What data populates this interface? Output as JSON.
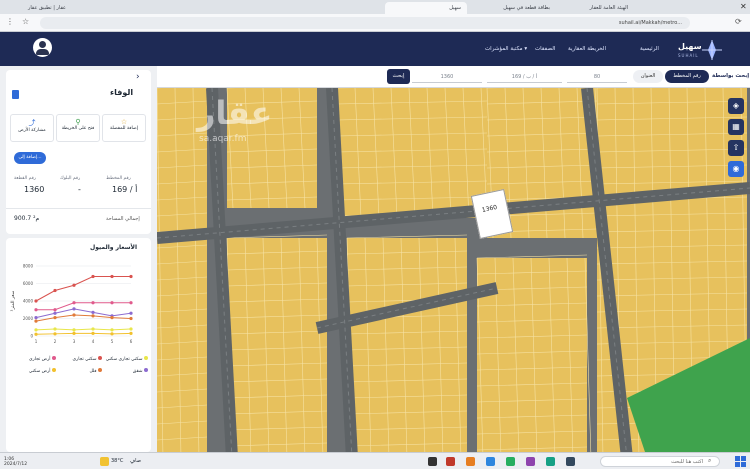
{
  "browser": {
    "tabs": [
      {
        "title": "عقار | تطبيق عقار"
      },
      {
        "title": "الهيئة العامة للعقار"
      },
      {
        "title": "بطاقة قطعة في سهيل"
      },
      {
        "title": "سهيل"
      }
    ],
    "url": "suhail.ai/Makkah/metro..."
  },
  "header": {
    "logo_text": "سهيل",
    "logo_sub": "SUHAIL",
    "nav": [
      "الرئيسية",
      "الخريطة العقارية",
      "الصفقات",
      "مكتبة المؤشرات"
    ]
  },
  "search": {
    "label": "إبحث بواسطة",
    "mode_active": "رقم المخطط",
    "mode_other": "العنوان",
    "field_1": "80",
    "field_2": "169 / أ / ب",
    "field_3": "1360",
    "button": "إبحث"
  },
  "panel": {
    "title": "الوفاء",
    "actions": [
      "إضافة للمفضلة",
      "فتح على الخريطة",
      "مشاركة الأرض"
    ],
    "add_button": "إضافة إلى...",
    "plan_label": "رقم المخطط",
    "plan_value": "169 / أ",
    "block_label": "رقم البلوك",
    "block_value": "-",
    "parcel_label": "رقم القطعة",
    "parcel_value": "1360",
    "area_label": "إجمالي المساحة",
    "area_value": "900.7",
    "area_unit": "م²"
  },
  "chart": {
    "title": "الأسعار والميول",
    "ylabel": "سعر المتر²",
    "legend": [
      {
        "label": "سكني تجاري سكني",
        "color": "#e8e64a"
      },
      {
        "label": "سكني تجاري",
        "color": "#d9534f"
      },
      {
        "label": "أرض تجاري",
        "color": "#e05a8c"
      },
      {
        "label": "شقق",
        "color": "#8c6bd0"
      },
      {
        "label": "فلل",
        "color": "#e07a3a"
      },
      {
        "label": "أرض سكني",
        "color": "#f2c12e"
      }
    ]
  },
  "chart_data": {
    "type": "line",
    "x": [
      "1",
      "2",
      "3",
      "4",
      "5",
      "6"
    ],
    "yticks": [
      "0",
      "2000",
      "4000",
      "6000",
      "8000"
    ],
    "ylim": [
      0,
      8000
    ],
    "series": [
      {
        "color": "#d9534f",
        "values": [
          4000,
          5200,
          5800,
          6800,
          6800,
          6800
        ]
      },
      {
        "color": "#e05a8c",
        "values": [
          3000,
          3000,
          3800,
          3800,
          3800,
          3800
        ]
      },
      {
        "color": "#8c6bd0",
        "values": [
          2100,
          2600,
          3100,
          2700,
          2300,
          2600
        ]
      },
      {
        "color": "#e07a3a",
        "values": [
          1700,
          2100,
          2400,
          2300,
          2100,
          2000
        ]
      },
      {
        "color": "#e8e64a",
        "values": [
          700,
          800,
          700,
          800,
          700,
          800
        ]
      },
      {
        "color": "#f2c12e",
        "values": [
          200,
          250,
          300,
          300,
          250,
          300
        ]
      }
    ]
  },
  "map": {
    "watermark": "عقار",
    "watermark_sub": "sa.aqar.fm",
    "selected_parcel": "1360"
  },
  "taskbar": {
    "weather": "38°C",
    "weather_desc": "صافٍ",
    "search_placeholder": "اكتب هنا للبحث",
    "time": "1:06",
    "date": "2024/7/12"
  },
  "colors": {
    "nav": "#1e2a55",
    "parcel": "#e7c15d",
    "accent": "#2f6bd8"
  }
}
